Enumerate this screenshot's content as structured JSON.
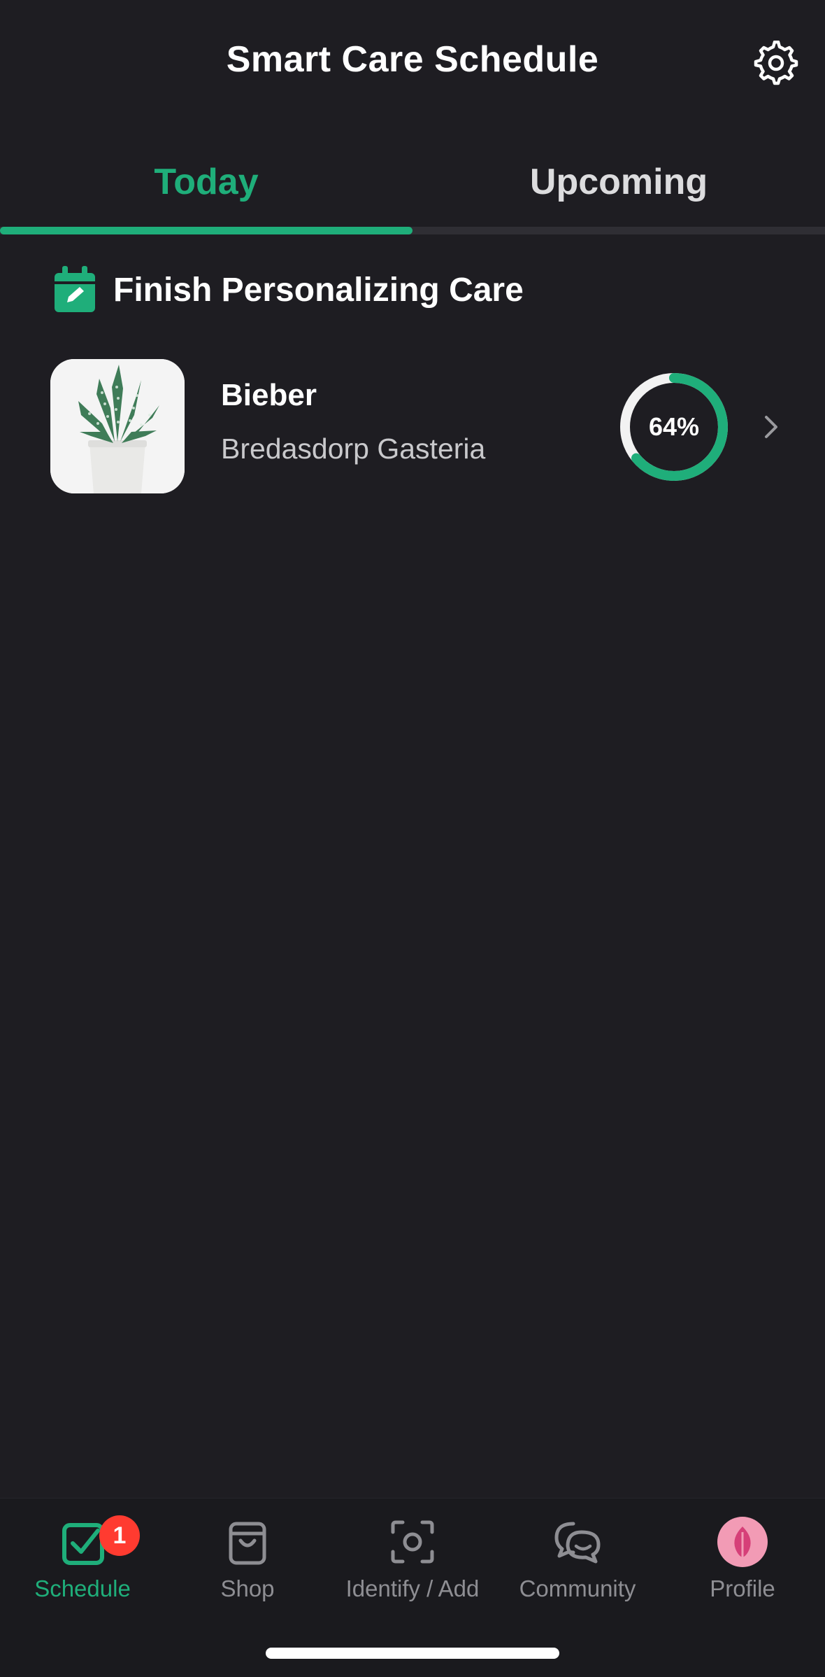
{
  "header": {
    "title": "Smart Care Schedule",
    "settings_icon": "gear-icon"
  },
  "tabs": [
    {
      "label": "Today",
      "active": true
    },
    {
      "label": "Upcoming",
      "active": false
    }
  ],
  "section": {
    "title": "Finish Personalizing Care",
    "icon": "calendar-edit-icon"
  },
  "plant": {
    "name": "Bieber",
    "species": "Bredasdorp Gasteria",
    "progress_text": "64%",
    "progress_fraction": 0.64
  },
  "tabbar": {
    "items": [
      {
        "label": "Schedule",
        "icon": "schedule-check-icon",
        "active": true,
        "badge": "1"
      },
      {
        "label": "Shop",
        "icon": "shopping-bag-icon",
        "active": false
      },
      {
        "label": "Identify / Add",
        "icon": "scan-camera-icon",
        "active": false
      },
      {
        "label": "Community",
        "icon": "chat-bubbles-icon",
        "active": false
      },
      {
        "label": "Profile",
        "icon": "avatar-leaf-icon",
        "active": false
      }
    ]
  },
  "colors": {
    "accent": "#1fae7a",
    "background": "#1e1d22",
    "badge": "#ff3b30",
    "avatar": "#f29bb5"
  }
}
